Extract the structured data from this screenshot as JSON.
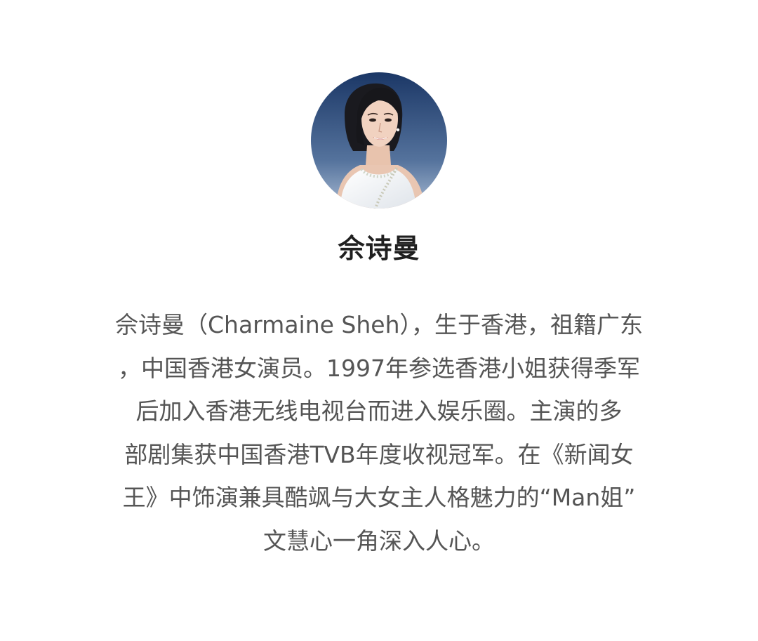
{
  "profile": {
    "avatar_icon": "person-portrait",
    "name": "佘诗曼",
    "bio_lines": [
      "佘诗曼（Charmaine Sheh），生于香港，祖籍广东",
      "，中国香港女演员。1997年参选香港小姐获得季军",
      "后加入香港无线电视台而进入娱乐圈。主演的多",
      "部剧集获中国香港TVB年度收视冠军。在《新闻女",
      "王》中饰演兼具酷飒与大女主人格魅力的“Man姐”",
      "文慧心一角深入人心。"
    ]
  },
  "colors": {
    "background": "#ffffff",
    "name_text": "#1f1f1f",
    "bio_text": "#555555",
    "avatar_bg_top": "#1b3766",
    "avatar_bg_bottom": "#9fb3cd"
  }
}
